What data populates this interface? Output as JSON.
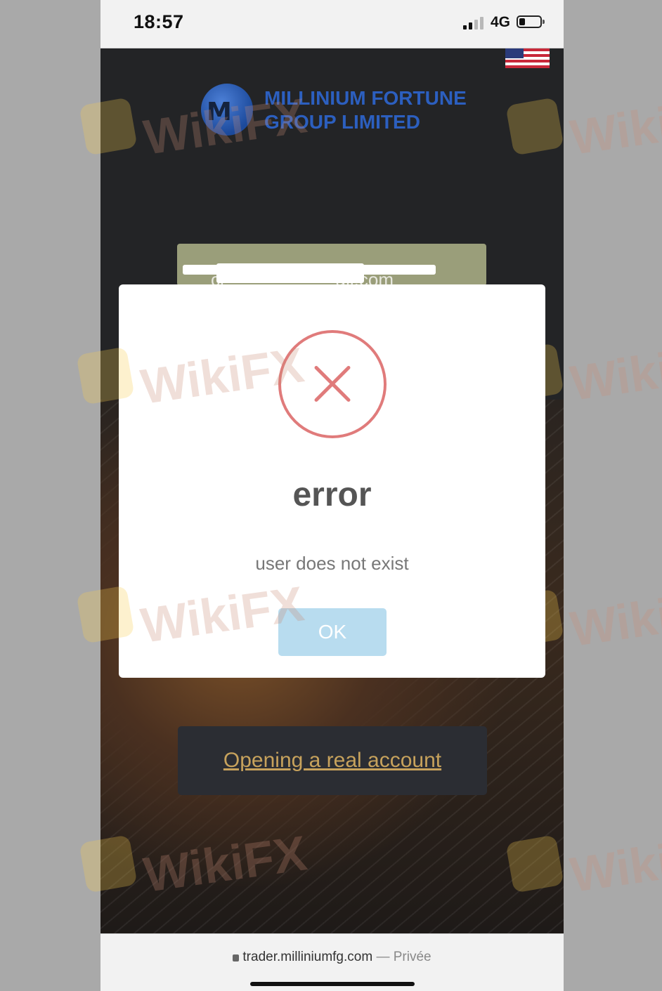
{
  "status_bar": {
    "time": "18:57",
    "network": "4G"
  },
  "site": {
    "logo_line1": "MILLINIUM FORTUNE",
    "logo_line2": "GROUP LIMITED",
    "email_value": "cr      ail.com",
    "open_account_link": "Opening a real account"
  },
  "dialog": {
    "title": "error",
    "message": "user does not exist",
    "ok_label": "OK"
  },
  "address_bar": {
    "url": "trader.milliniumfg.com",
    "separator": "—",
    "mode": "Privée"
  },
  "watermark": "WikiFX",
  "colors": {
    "error_red": "#e07b7b",
    "ok_button": "#b8dcef",
    "link_gold": "#c7a25c",
    "logo_blue": "#2c5fbf"
  }
}
